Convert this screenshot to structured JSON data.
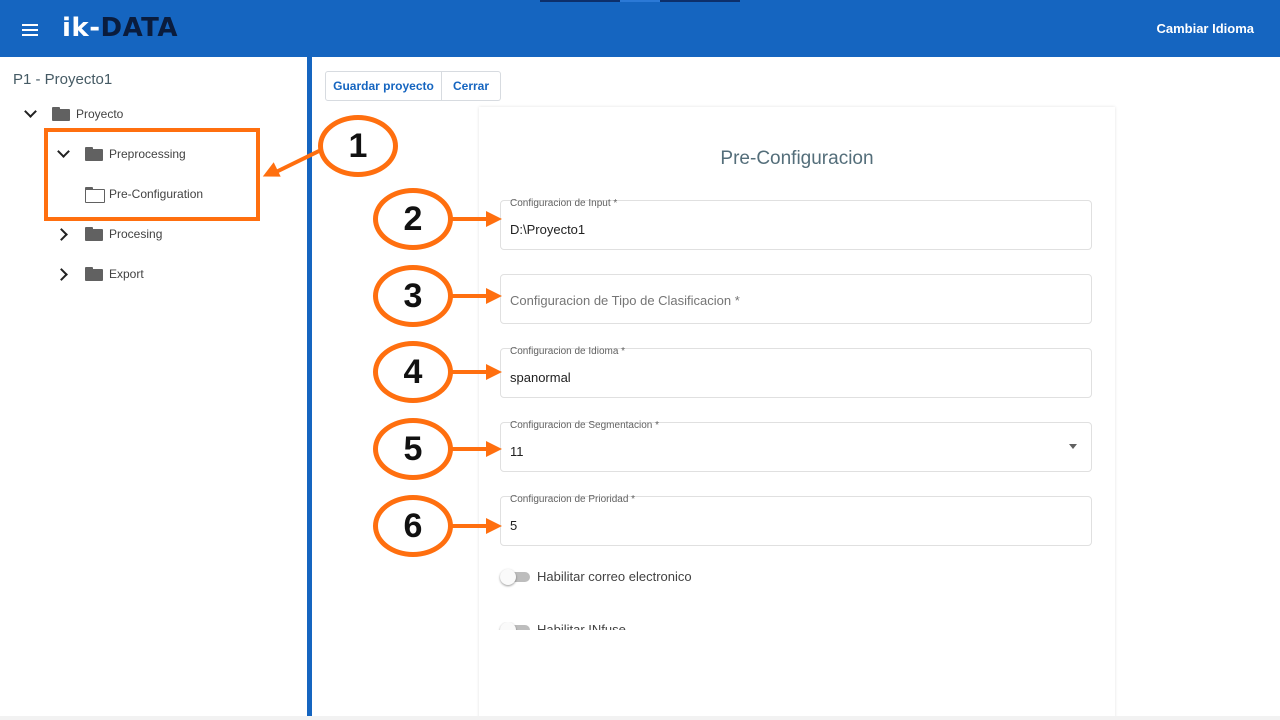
{
  "header": {
    "logo_ik": "ik-",
    "logo_data": "DATA",
    "lang_button": "Cambiar Idioma"
  },
  "sidebar": {
    "project_title": "P1 - Proyecto1",
    "tree": {
      "root": "Proyecto",
      "preprocessing": "Preprocessing",
      "preconfiguration": "Pre-Configuration",
      "procesing": "Procesing",
      "export": "Export"
    }
  },
  "toolbar": {
    "save_label": "Guardar proyecto",
    "close_label": "Cerrar"
  },
  "form": {
    "title": "Pre-Configuracion",
    "input": {
      "label": "Configuracion de Input *",
      "value": "D:\\Proyecto1"
    },
    "tipo": {
      "placeholder": "Configuracion de Tipo de Clasificacion *"
    },
    "idioma": {
      "label": "Configuracion de Idioma *",
      "value": "spanormal"
    },
    "segmentacion": {
      "label": "Configuracion de Segmentacion *",
      "value": "11"
    },
    "prioridad": {
      "label": "Configuracion de Prioridad *",
      "value": "5"
    },
    "toggle_correo": {
      "label": "Habilitar correo electronico",
      "enabled": false
    },
    "toggle_infuse": {
      "label": "Habilitar INfuse",
      "enabled": false
    }
  },
  "annotations": {
    "markers": [
      "1",
      "2",
      "3",
      "4",
      "5",
      "6"
    ],
    "color": "#ff6f0f"
  },
  "colors": {
    "header_bg": "#1565c0",
    "accent": "#1565c0",
    "title": "#546e7a"
  }
}
